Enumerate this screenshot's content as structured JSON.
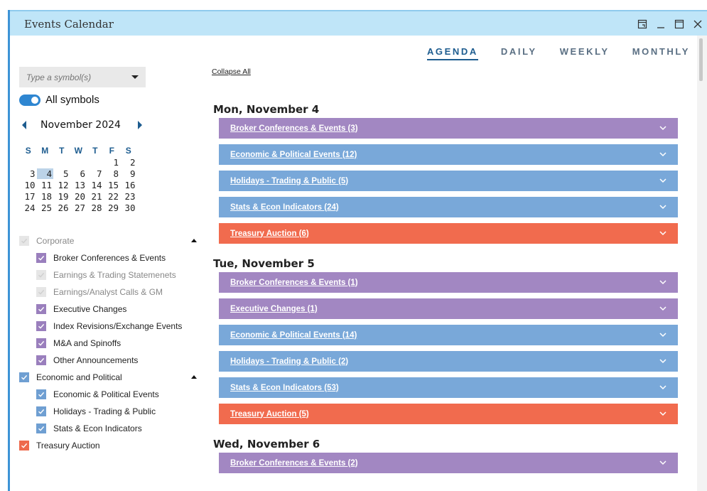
{
  "window": {
    "title": "Events Calendar"
  },
  "view_tabs": [
    {
      "label": "AGENDA",
      "active": true
    },
    {
      "label": "DAILY",
      "active": false
    },
    {
      "label": "WEEKLY",
      "active": false
    },
    {
      "label": "MONTHLY",
      "active": false
    }
  ],
  "sidebar": {
    "symbol_placeholder": "Type a symbol(s)",
    "all_symbols_label": "All symbols",
    "all_symbols_on": true,
    "month_label": "November 2024",
    "weekdays": [
      "S",
      "M",
      "T",
      "W",
      "T",
      "F",
      "S"
    ],
    "weeks": [
      [
        "",
        "",
        "",
        "",
        "",
        "1",
        "2"
      ],
      [
        "3",
        "4",
        "5",
        "6",
        "7",
        "8",
        "9"
      ],
      [
        "10",
        "11",
        "12",
        "13",
        "14",
        "15",
        "16"
      ],
      [
        "17",
        "18",
        "19",
        "20",
        "21",
        "22",
        "23"
      ],
      [
        "24",
        "25",
        "26",
        "27",
        "28",
        "29",
        "30"
      ]
    ],
    "selected_day": "4",
    "filters": [
      {
        "label": "Corporate",
        "level": 0,
        "checked": false,
        "color": "grey",
        "collapsible": true
      },
      {
        "label": "Broker Conferences & Events",
        "level": 1,
        "checked": true,
        "color": "purple"
      },
      {
        "label": "Earnings & Trading Statemenets",
        "level": 1,
        "checked": false,
        "color": "grey"
      },
      {
        "label": "Earnings/Analyst Calls & GM",
        "level": 1,
        "checked": false,
        "color": "grey"
      },
      {
        "label": "Executive Changes",
        "level": 1,
        "checked": true,
        "color": "purple"
      },
      {
        "label": "Index Revisions/Exchange Events",
        "level": 1,
        "checked": true,
        "color": "purple"
      },
      {
        "label": "M&A and Spinoffs",
        "level": 1,
        "checked": true,
        "color": "purple"
      },
      {
        "label": "Other Announcements",
        "level": 1,
        "checked": true,
        "color": "purple"
      },
      {
        "label": "Economic and Political",
        "level": 0,
        "checked": true,
        "color": "blue",
        "collapsible": true
      },
      {
        "label": "Economic & Political Events",
        "level": 1,
        "checked": true,
        "color": "blue"
      },
      {
        "label": "Holidays - Trading & Public",
        "level": 1,
        "checked": true,
        "color": "blue"
      },
      {
        "label": "Stats & Econ Indicators",
        "level": 1,
        "checked": true,
        "color": "blue"
      },
      {
        "label": "Treasury Auction",
        "level": 0,
        "checked": true,
        "color": "orange"
      }
    ]
  },
  "main": {
    "collapse_all": "Collapse All",
    "days": [
      {
        "title": "Mon, November 4",
        "events": [
          {
            "label": "Broker Conferences & Events (3)",
            "color": "purple"
          },
          {
            "label": "Economic & Political Events (12)",
            "color": "blue"
          },
          {
            "label": "Holidays - Trading & Public (5)",
            "color": "blue"
          },
          {
            "label": "Stats & Econ Indicators (24)",
            "color": "blue"
          },
          {
            "label": "Treasury Auction (6)",
            "color": "orange"
          }
        ]
      },
      {
        "title": "Tue, November 5",
        "events": [
          {
            "label": "Broker Conferences & Events (1)",
            "color": "purple"
          },
          {
            "label": "Executive Changes (1)",
            "color": "purple"
          },
          {
            "label": "Economic & Political Events (14)",
            "color": "blue"
          },
          {
            "label": "Holidays - Trading & Public (2)",
            "color": "blue"
          },
          {
            "label": "Stats & Econ Indicators (53)",
            "color": "blue"
          },
          {
            "label": "Treasury Auction (5)",
            "color": "orange"
          }
        ]
      },
      {
        "title": "Wed, November 6",
        "events": [
          {
            "label": "Broker Conferences & Events (2)",
            "color": "purple"
          }
        ]
      }
    ]
  },
  "colors": {
    "purple": "#a287c2",
    "blue": "#79a8d9",
    "orange": "#f16b4e",
    "accent": "#1d5c8f",
    "titlebar": "#bfe5f8"
  }
}
